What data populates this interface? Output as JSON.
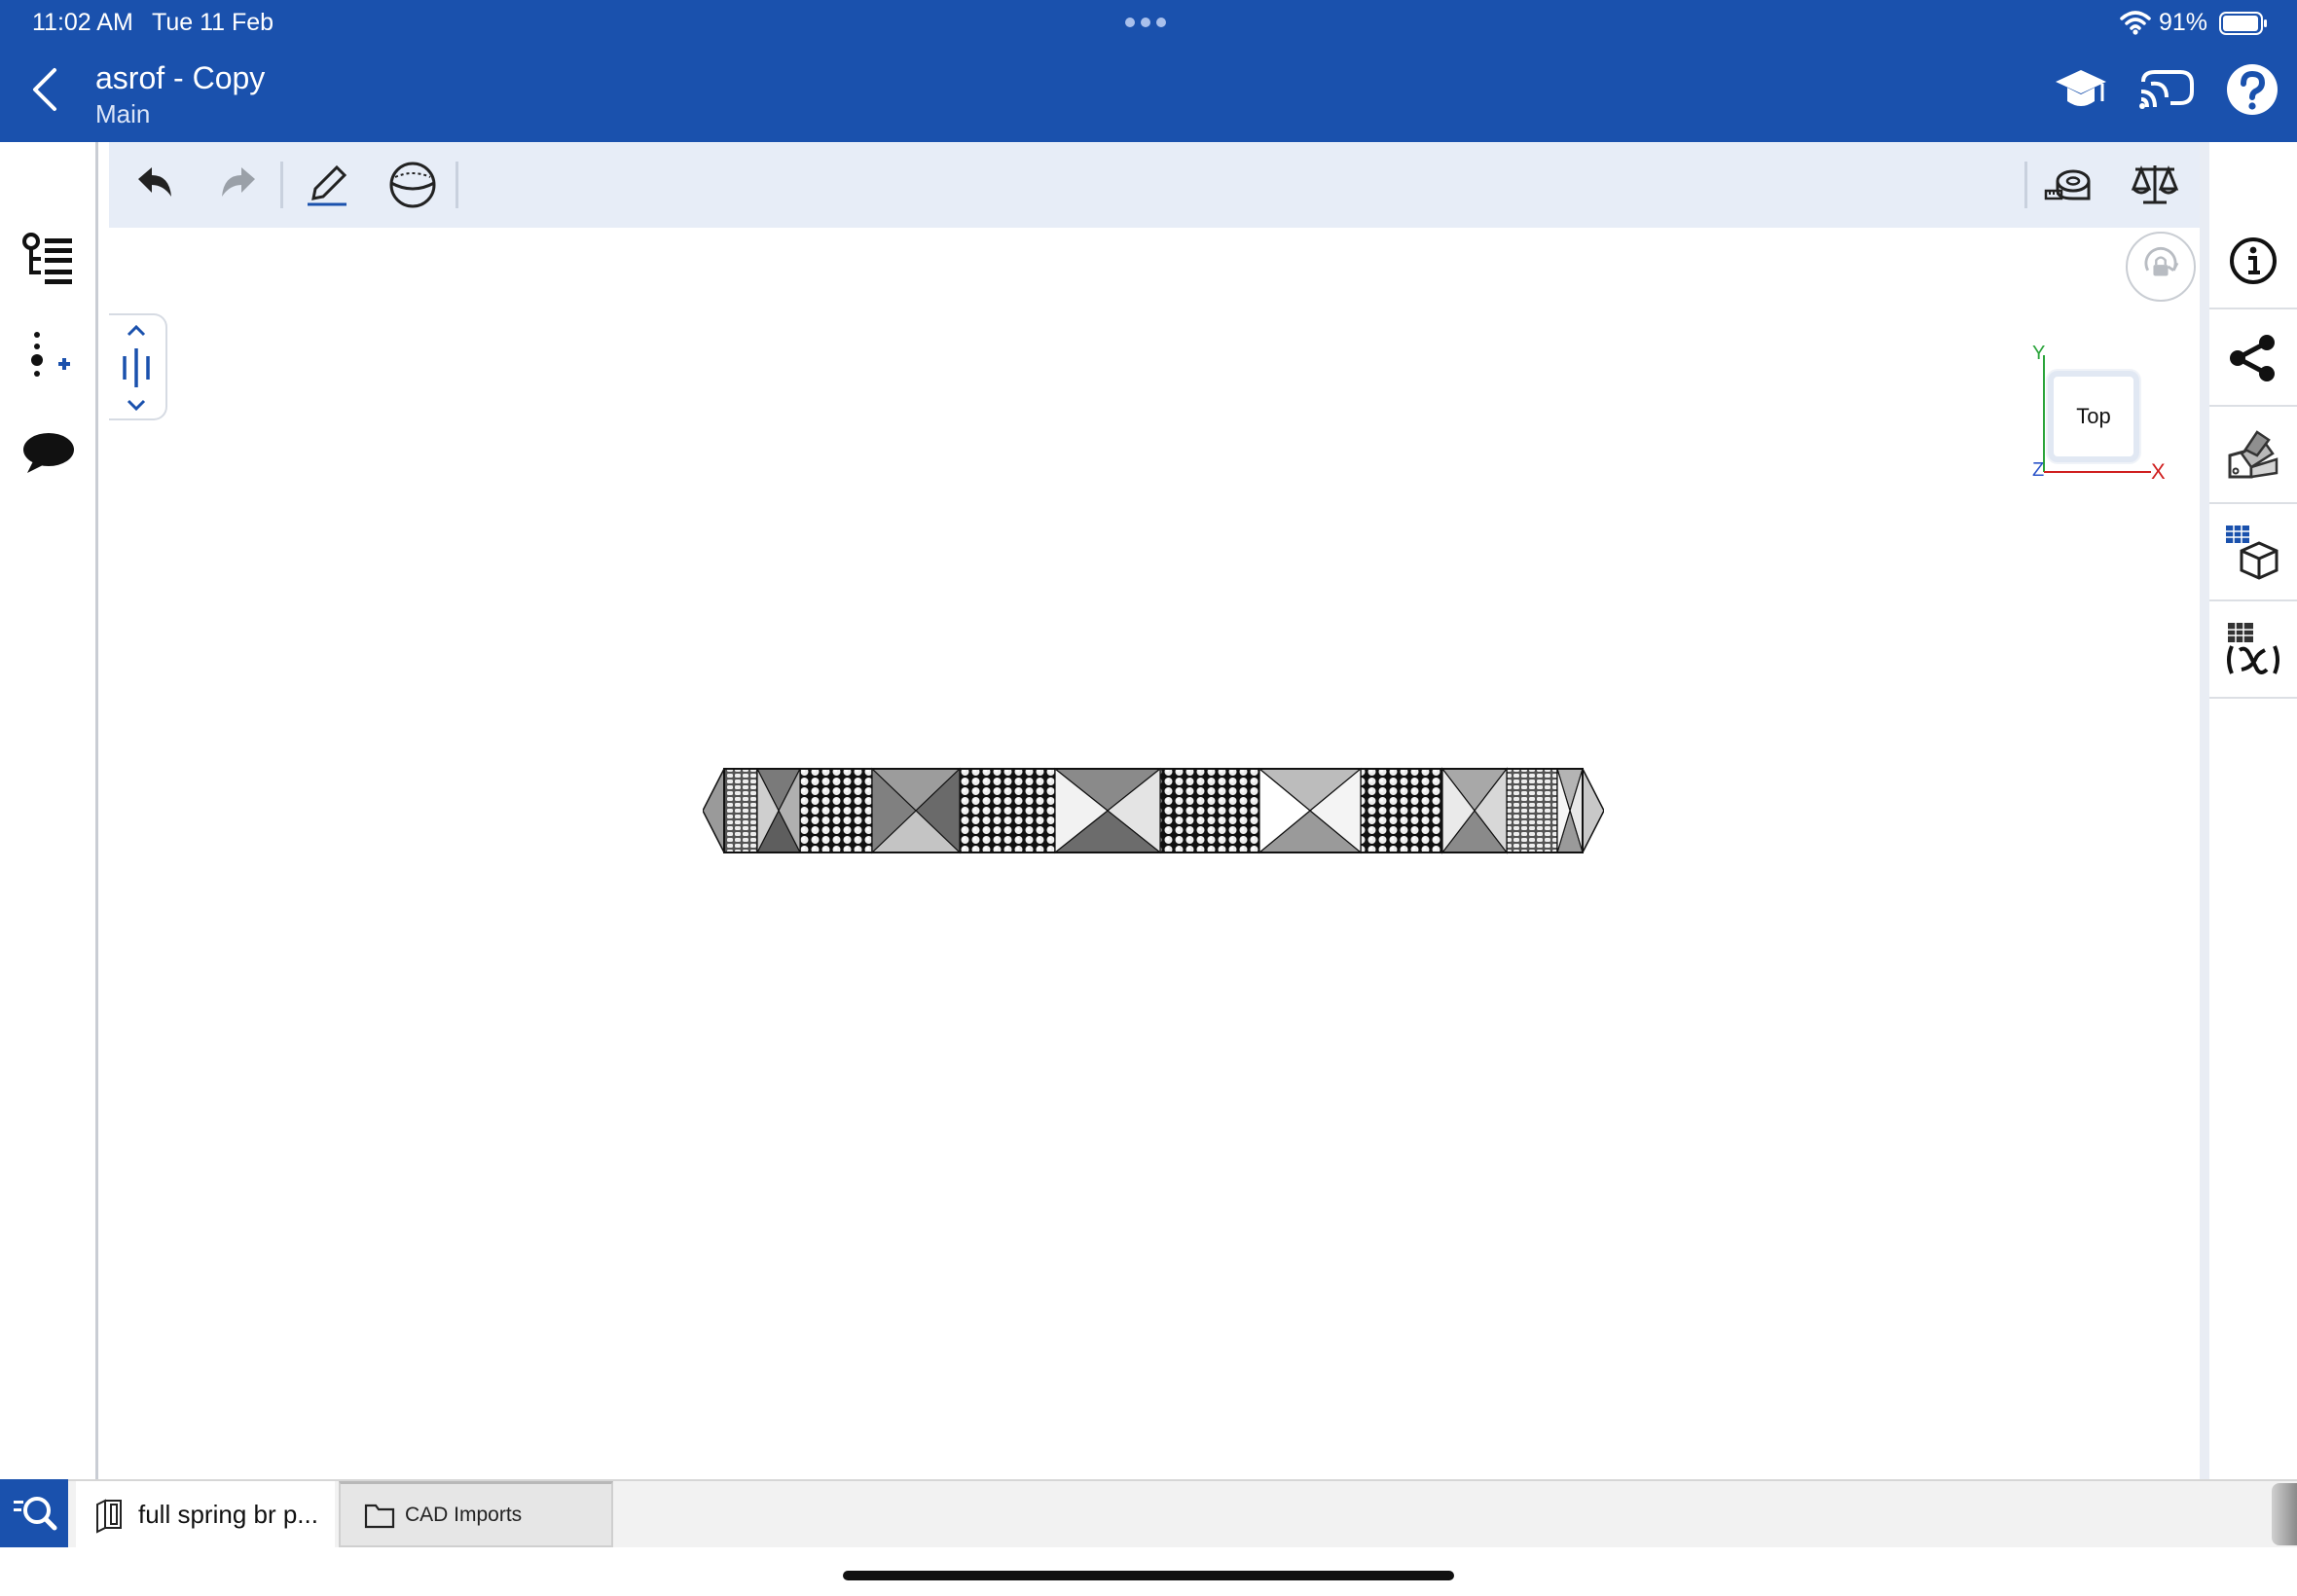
{
  "status_bar": {
    "time": "11:02 AM",
    "date": "Tue 11 Feb",
    "battery": "91%"
  },
  "header": {
    "title": "asrof - Copy",
    "subtitle": "Main"
  },
  "icons": {
    "back": "chevron-left-icon",
    "learning": "graduation-cap-icon",
    "cast": "cast-icon",
    "help": "help-icon",
    "undo": "undo-icon",
    "redo": "redo-icon",
    "sketch": "pencil-icon",
    "display_style": "sphere-icon",
    "measure": "tape-measure-icon",
    "mass_properties": "balance-scale-icon",
    "feature_list": "feature-list-icon",
    "add_mate": "add-mate-icon",
    "comments": "comment-icon",
    "rotation_lock": "rotation-lock-icon",
    "named_views": "plane-slider-icon",
    "info": "info-icon",
    "share": "share-icon",
    "appearance": "appearance-swatch-icon",
    "configurations": "configuration-table-icon",
    "variables": "variables-icon",
    "search": "search-icon",
    "part_studio_tab": "part-studio-icon",
    "folder_tab": "folder-icon"
  },
  "viewcube": {
    "face_label": "Top",
    "axis_x": "X",
    "axis_y": "Y",
    "axis_z": "Z"
  },
  "tabs": [
    {
      "label": "full spring br p..."
    },
    {
      "label": "CAD Imports"
    }
  ],
  "colors": {
    "brand_blue": "#1a51ad",
    "toolbar_bg": "#e7edf7",
    "axis_x": "#d02020",
    "axis_y": "#2aa43a",
    "axis_z": "#2d55c9"
  }
}
